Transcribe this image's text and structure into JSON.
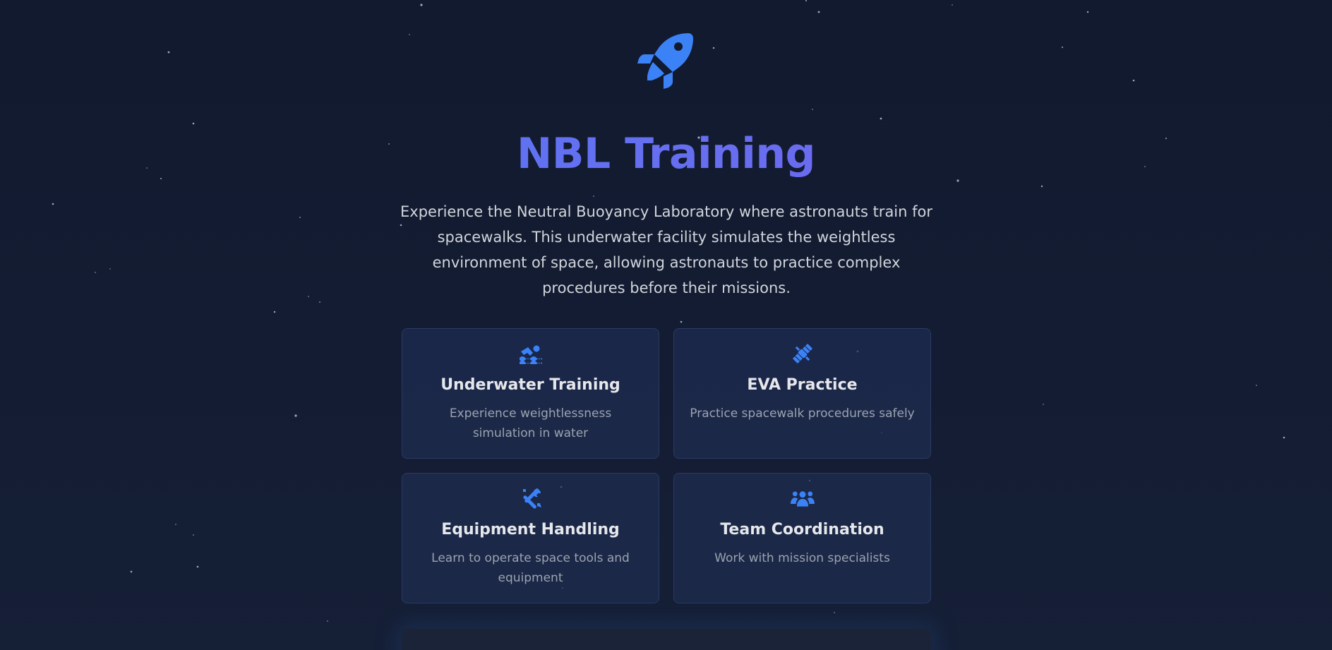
{
  "colors": {
    "background": "#121a2f",
    "accent": "#3b82f6",
    "title_gradient_start": "#4f7cf3",
    "title_gradient_end": "#8b5cf6",
    "card_background": "#1e2d50",
    "card_border": "#2a3a62",
    "body_text": "#d1d5db",
    "muted_text": "#9ca3af"
  },
  "hero": {
    "icon": "rocket-icon",
    "title": "NBL Training",
    "description": "Experience the Neutral Buoyancy Laboratory where astronauts train for spacewalks. This underwater facility simulates the weightless environment of space, allowing astronauts to practice complex procedures before their missions."
  },
  "features": [
    {
      "icon": "swimmer-icon",
      "title": "Underwater Training",
      "description": "Experience weightlessness simulation in water"
    },
    {
      "icon": "satellite-icon",
      "title": "EVA Practice",
      "description": "Practice spacewalk procedures safely"
    },
    {
      "icon": "tools-icon",
      "title": "Equipment Handling",
      "description": "Learn to operate space tools and equipment"
    },
    {
      "icon": "team-icon",
      "title": "Team Coordination",
      "description": "Work with mission specialists"
    }
  ]
}
